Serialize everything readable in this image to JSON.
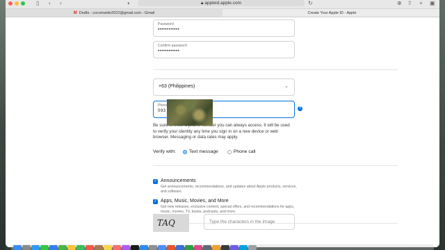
{
  "browser": {
    "url": "appleid.apple.com",
    "tabs": [
      {
        "label": "Drafts - cocomartin2022@gmail.com - Gmail",
        "icon": "gmail-icon",
        "active": false
      },
      {
        "label": "Create Your Apple ID - Apple",
        "icon": "apple-icon",
        "active": true
      }
    ]
  },
  "form": {
    "password": {
      "label": "Password",
      "value": "••••••••••••"
    },
    "confirm_password": {
      "label": "Confirm password",
      "value": "••••••••••••"
    },
    "country": {
      "value": "+63 (Philippines)"
    },
    "phone": {
      "label": "Phone number",
      "value": "093"
    },
    "phone_help": "Be sure to enter a phone number you can always access. It will be used to verify your identity any time you sign in on a new device or web browser. Messaging or data rates may apply.",
    "verify": {
      "label": "Verify with:",
      "options": [
        {
          "label": "Text message",
          "checked": true
        },
        {
          "label": "Phone call",
          "checked": false
        }
      ]
    },
    "subscriptions": [
      {
        "title": "Announcements",
        "description": "Get announcements, recommendations, and updates about Apple products, services, and software.",
        "checked": true
      },
      {
        "title": "Apps, Music, Movies, and More",
        "description": "Get new releases, exclusive content, special offers, and recommendations for apps, music, movies, TV, books, podcasts, and more.",
        "checked": true
      }
    ],
    "captcha": {
      "image_text": "TAQ",
      "placeholder": "Type the characters in the image"
    }
  },
  "colors": {
    "accent": "#0071e3"
  }
}
